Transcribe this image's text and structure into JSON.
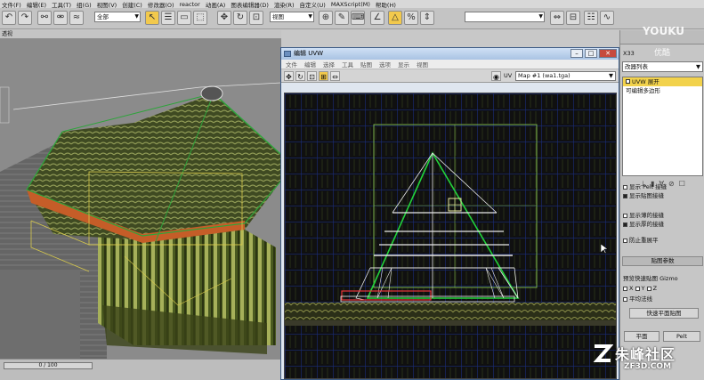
{
  "menubar": {
    "items": [
      "文件(F)",
      "编辑(E)",
      "工具(T)",
      "组(G)",
      "视图(V)",
      "创建(C)",
      "修改器(O)",
      "reactor",
      "动画(A)",
      "图表编辑器(D)",
      "渲染(R)",
      "自定义(U)",
      "MAXScript(M)",
      "帮助(H)"
    ]
  },
  "toolbar": {
    "selection_filter": "全部",
    "ref_coord": "视图"
  },
  "viewport": {
    "label": "透视"
  },
  "timebar": {
    "frame_readout": "0 / 100"
  },
  "uvw_window": {
    "title": "编辑 UVW",
    "menu": [
      "文件",
      "编辑",
      "选择",
      "工具",
      "贴图",
      "选项",
      "显示",
      "视图"
    ],
    "uv_label": "UV",
    "map_select": "Map #1 (wa1.tga)"
  },
  "command_panel": {
    "top_label": "X33",
    "modifier_list": "改器列表",
    "stack": [
      {
        "label": "UVW 展开",
        "selected": true
      },
      {
        "label": "可编辑多边形",
        "selected": false
      }
    ],
    "options": [
      {
        "label": "显示 Pelt 接缝",
        "checked": false
      },
      {
        "label": "显示贴图接缝",
        "checked": true
      },
      {
        "label": "显示薄的接缝",
        "checked": false
      },
      {
        "label": "显示厚的接缝",
        "checked": true
      },
      {
        "label": "防止重展平",
        "checked": false
      }
    ],
    "map_params_header": "贴图参数",
    "preview_label": "预览快速贴图 Gizmo",
    "axis_x": "X",
    "axis_y": "Y",
    "axis_z": "Z",
    "average_normals": "平均法线",
    "quick_planar_button": "快速平面贴图",
    "planar_button": "平面",
    "pelt_button": "Pelt"
  },
  "watermarks": {
    "youku": "YOUKU",
    "youku_sub": "优酷",
    "brand": "朱峰社区",
    "url": "ZF3D.COM"
  }
}
